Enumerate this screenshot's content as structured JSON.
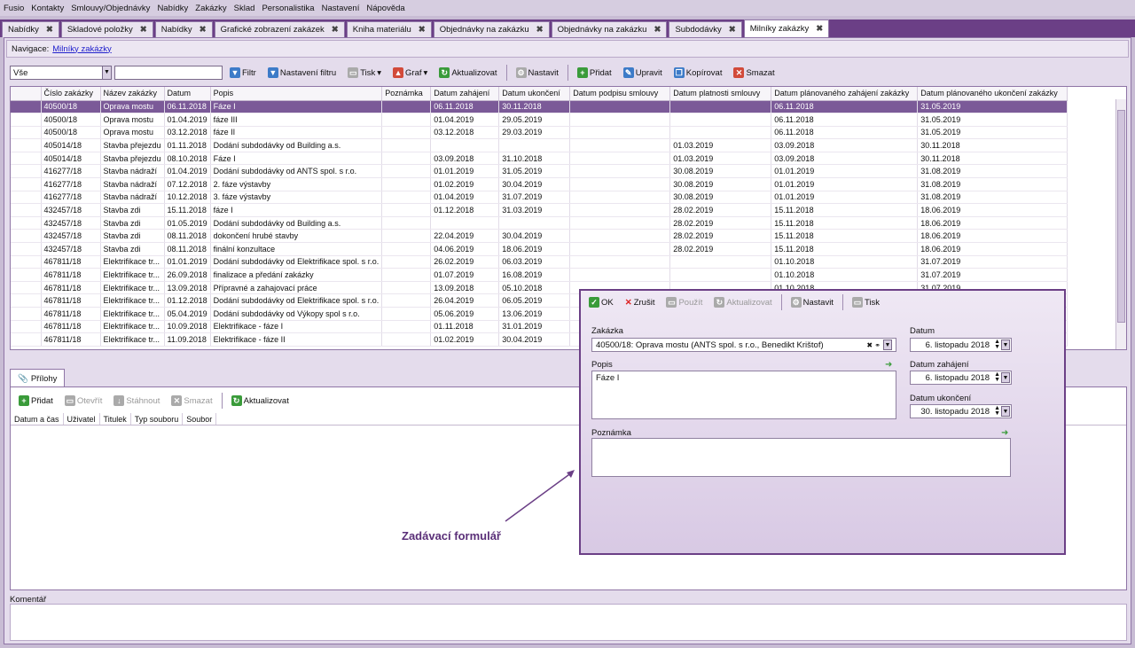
{
  "menu": [
    "Fusio",
    "Kontakty",
    "Smlouvy/Objednávky",
    "Nabídky",
    "Zakázky",
    "Sklad",
    "Personalistika",
    "Nastavení",
    "Nápověda"
  ],
  "tabs": [
    {
      "label": "Nabídky",
      "active": false
    },
    {
      "label": "Skladové položky",
      "active": false
    },
    {
      "label": "Nabídky",
      "active": false
    },
    {
      "label": "Grafické zobrazení zakázek",
      "active": false
    },
    {
      "label": "Kniha materiálu",
      "active": false
    },
    {
      "label": "Objednávky na zakázku",
      "active": false
    },
    {
      "label": "Objednávky na zakázku",
      "active": false
    },
    {
      "label": "Subdodávky",
      "active": false
    },
    {
      "label": "Milníky zakázky",
      "active": true
    }
  ],
  "nav": {
    "label": "Navigace:",
    "link": "Milníky zakázky"
  },
  "toolbar": {
    "filter_value": "Vše",
    "filter": "Filtr",
    "filter_settings": "Nastavení filtru",
    "print": "Tisk",
    "graph": "Graf",
    "refresh": "Aktualizovat",
    "setup": "Nastavit",
    "add": "Přidat",
    "edit": "Upravit",
    "copy": "Kopírovat",
    "delete": "Smazat"
  },
  "grid": {
    "columns": [
      "Číslo zakázky",
      "Název zakázky",
      "Datum",
      "Popis",
      "Poznámka",
      "Datum zahájení",
      "Datum ukončení",
      "Datum podpisu smlouvy",
      "Datum platnosti smlouvy",
      "Datum plánovaného zahájení zakázky",
      "Datum plánovaného ukončení zakázky"
    ],
    "rows": [
      [
        "40500/18",
        "Oprava mostu",
        "06.11.2018",
        "Fáze I",
        "",
        "06.11.2018",
        "30.11.2018",
        "",
        "",
        "06.11.2018",
        "31.05.2019"
      ],
      [
        "40500/18",
        "Oprava mostu",
        "01.04.2019",
        "fáze III",
        "",
        "01.04.2019",
        "29.05.2019",
        "",
        "",
        "06.11.2018",
        "31.05.2019"
      ],
      [
        "40500/18",
        "Oprava mostu",
        "03.12.2018",
        "fáze II",
        "",
        "03.12.2018",
        "29.03.2019",
        "",
        "",
        "06.11.2018",
        "31.05.2019"
      ],
      [
        "405014/18",
        "Stavba přejezdu",
        "01.11.2018",
        "Dodání subdodávky od Building a.s.",
        "",
        "",
        "",
        "",
        "01.03.2019",
        "03.09.2018",
        "30.11.2018"
      ],
      [
        "405014/18",
        "Stavba přejezdu",
        "08.10.2018",
        "Fáze I",
        "",
        "03.09.2018",
        "31.10.2018",
        "",
        "01.03.2019",
        "03.09.2018",
        "30.11.2018"
      ],
      [
        "416277/18",
        "Stavba nádraží",
        "01.04.2019",
        "Dodání subdodávky od ANTS spol. s r.o.",
        "",
        "01.01.2019",
        "31.05.2019",
        "",
        "30.08.2019",
        "01.01.2019",
        "31.08.2019"
      ],
      [
        "416277/18",
        "Stavba nádraží",
        "07.12.2018",
        "2. fáze výstavby",
        "",
        "01.02.2019",
        "30.04.2019",
        "",
        "30.08.2019",
        "01.01.2019",
        "31.08.2019"
      ],
      [
        "416277/18",
        "Stavba nádraží",
        "10.12.2018",
        "3. fáze výstavby",
        "",
        "01.04.2019",
        "31.07.2019",
        "",
        "30.08.2019",
        "01.01.2019",
        "31.08.2019"
      ],
      [
        "432457/18",
        "Stavba zdi",
        "15.11.2018",
        "fáze I",
        "",
        "01.12.2018",
        "31.03.2019",
        "",
        "28.02.2019",
        "15.11.2018",
        "18.06.2019"
      ],
      [
        "432457/18",
        "Stavba zdi",
        "01.05.2019",
        "Dodání subdodávky od Building a.s.",
        "",
        "",
        "",
        "",
        "28.02.2019",
        "15.11.2018",
        "18.06.2019"
      ],
      [
        "432457/18",
        "Stavba zdi",
        "08.11.2018",
        "dokončení hrubé stavby",
        "",
        "22.04.2019",
        "30.04.2019",
        "",
        "28.02.2019",
        "15.11.2018",
        "18.06.2019"
      ],
      [
        "432457/18",
        "Stavba zdi",
        "08.11.2018",
        "finální konzultace",
        "",
        "04.06.2019",
        "18.06.2019",
        "",
        "28.02.2019",
        "15.11.2018",
        "18.06.2019"
      ],
      [
        "467811/18",
        "Elektrifikace tr...",
        "01.01.2019",
        "Dodání subdodávky od Elektrifikace spol. s r.o.",
        "",
        "26.02.2019",
        "06.03.2019",
        "",
        "",
        "01.10.2018",
        "31.07.2019"
      ],
      [
        "467811/18",
        "Elektrifikace tr...",
        "26.09.2018",
        "finalizace a předání zakázky",
        "",
        "01.07.2019",
        "16.08.2019",
        "",
        "",
        "01.10.2018",
        "31.07.2019"
      ],
      [
        "467811/18",
        "Elektrifikace tr...",
        "13.09.2018",
        "Přípravné a zahajovací práce",
        "",
        "13.09.2018",
        "05.10.2018",
        "",
        "",
        "01.10.2018",
        "31.07.2019"
      ],
      [
        "467811/18",
        "Elektrifikace tr...",
        "01.12.2018",
        "Dodání subdodávky od Elektrifikace spol. s r.o.",
        "",
        "26.04.2019",
        "06.05.2019",
        "",
        "",
        "",
        ""
      ],
      [
        "467811/18",
        "Elektrifikace tr...",
        "05.04.2019",
        "Dodání subdodávky od Výkopy spol s r.o.",
        "",
        "05.06.2019",
        "13.06.2019",
        "",
        "",
        "",
        ""
      ],
      [
        "467811/18",
        "Elektrifikace tr...",
        "10.09.2018",
        "Elektrifikace - fáze I",
        "",
        "01.11.2018",
        "31.01.2019",
        "",
        "",
        "",
        ""
      ],
      [
        "467811/18",
        "Elektrifikace tr...",
        "11.09.2018",
        "Elektrifikace - fáze II",
        "",
        "01.02.2019",
        "30.04.2019",
        "",
        "",
        "",
        ""
      ]
    ]
  },
  "attachments": {
    "tab": "Přílohy",
    "add": "Přidat",
    "open": "Otevřít",
    "download": "Stáhnout",
    "delete": "Smazat",
    "refresh": "Aktualizovat",
    "columns": [
      "Datum a čas",
      "Uživatel",
      "Titulek",
      "Typ souboru",
      "Soubor"
    ]
  },
  "comment_label": "Komentář",
  "dialog": {
    "ok": "OK",
    "cancel": "Zrušit",
    "use": "Použít",
    "refresh": "Aktualizovat",
    "setup": "Nastavit",
    "print": "Tisk",
    "order_label": "Zakázka",
    "order_value": "40500/18: Oprava mostu (ANTS spol. s r.o., Benedikt Krištof)",
    "description_label": "Popis",
    "description_value": "Fáze I",
    "note_label": "Poznámka",
    "date_label": "Datum",
    "date_value": "6. listopadu 2018",
    "start_label": "Datum zahájení",
    "start_value": "6. listopadu 2018",
    "end_label": "Datum ukončení",
    "end_value": "30. listopadu 2018"
  },
  "annotation": "Zadávací formulář"
}
